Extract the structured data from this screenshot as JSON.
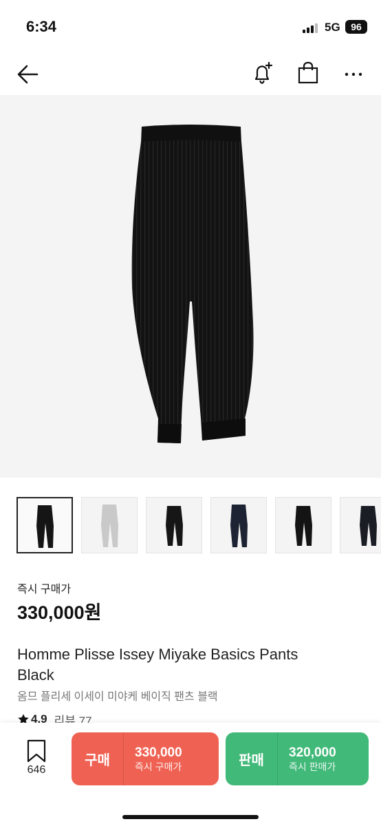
{
  "status_bar": {
    "time": "6:34",
    "network": "5G",
    "battery": "96"
  },
  "nav": {
    "back_icon": "arrow-left-icon",
    "alert_icon": "bell-plus-icon",
    "bag_icon": "shopping-bag-icon",
    "more_icon": "more-horizontal-icon"
  },
  "product": {
    "colors": {
      "thumb_active_border": "#222222",
      "buy": "#ef6253",
      "sell": "#41b979"
    },
    "thumbnails": [
      {
        "color": "black",
        "active": true
      },
      {
        "color": "light-gray",
        "active": false
      },
      {
        "color": "black",
        "active": false
      },
      {
        "color": "navy",
        "active": false
      },
      {
        "color": "black",
        "active": false
      },
      {
        "color": "black",
        "active": false
      }
    ],
    "price_label": "즉시 구매가",
    "price": "330,000원",
    "title_en": "Homme Plisse Issey Miyake Basics Pants Black",
    "title_ko": "옴므 플리세 이세이 미야케 베이직 팬츠 블랙",
    "rating": "4.9",
    "review_text": "리뷰 77"
  },
  "bottom_bar": {
    "wish_count": "646",
    "buy": {
      "label": "구매",
      "price": "330,000",
      "sub": "즉시 구매가"
    },
    "sell": {
      "label": "판매",
      "price": "320,000",
      "sub": "즉시 판매가"
    }
  }
}
